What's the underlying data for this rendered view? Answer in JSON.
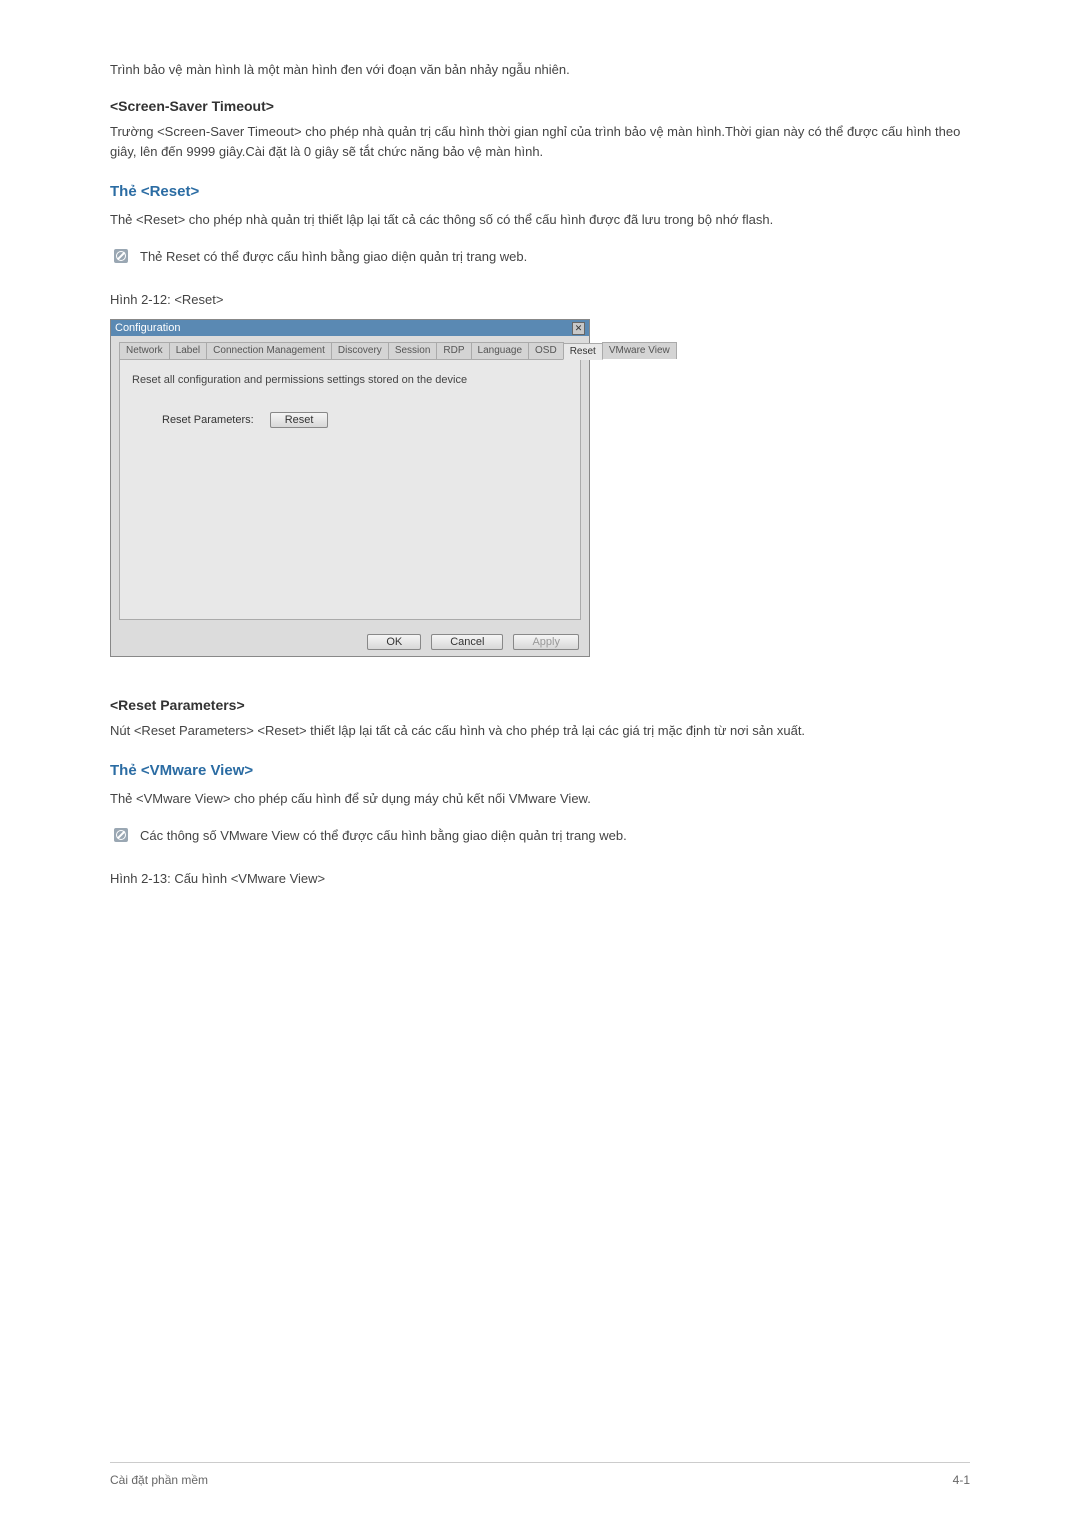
{
  "intro": "Trình bảo vệ màn hình là một màn hình đen với đoạn văn bản nhảy ngẫu nhiên.",
  "screensaver": {
    "heading": "<Screen-Saver Timeout>",
    "body": "Trường <Screen-Saver Timeout> cho phép nhà quản trị cấu hình thời gian nghỉ của trình bảo vệ màn hình.Thời gian này có thể được cấu hình theo giây, lên đến 9999 giây.Cài đặt là 0 giây sẽ tắt chức năng bảo vệ màn hình."
  },
  "reset_section": {
    "heading": "Thẻ <Reset>",
    "body": "Thẻ <Reset> cho phép nhà quản trị thiết lập lại tất cả các thông số có thể cấu hình được đã lưu trong bộ nhớ flash.",
    "note": "Thẻ Reset có thể được cấu hình bằng giao diện quản trị trang web.",
    "figure_caption": "Hình 2-12: <Reset>"
  },
  "dialog": {
    "title": "Configuration",
    "close_glyph": "✕",
    "tabs": [
      "Network",
      "Label",
      "Connection Management",
      "Discovery",
      "Session",
      "RDP",
      "Language",
      "OSD",
      "Reset",
      "VMware View"
    ],
    "active_tab_index": 8,
    "description": "Reset all configuration and permissions settings stored on the device",
    "param_label": "Reset Parameters:",
    "reset_button": "Reset",
    "ok": "OK",
    "cancel": "Cancel",
    "apply": "Apply"
  },
  "reset_params": {
    "heading": "<Reset Parameters>",
    "body": "Nút <Reset Parameters> <Reset> thiết lập lại tất cả các cấu hình và cho phép trả lại các giá trị mặc định từ nơi sản xuất."
  },
  "vmware_section": {
    "heading": "Thẻ <VMware View>",
    "body": "Thẻ <VMware View> cho phép cấu hình để sử dụng máy chủ kết nối VMware View.",
    "note": "Các thông số VMware View có thể được cấu hình bằng giao diện quản trị trang web.",
    "figure_caption": "Hình 2-13: Cấu hình <VMware View>"
  },
  "footer": {
    "left": "Cài đặt phần mềm",
    "right": "4-1"
  }
}
